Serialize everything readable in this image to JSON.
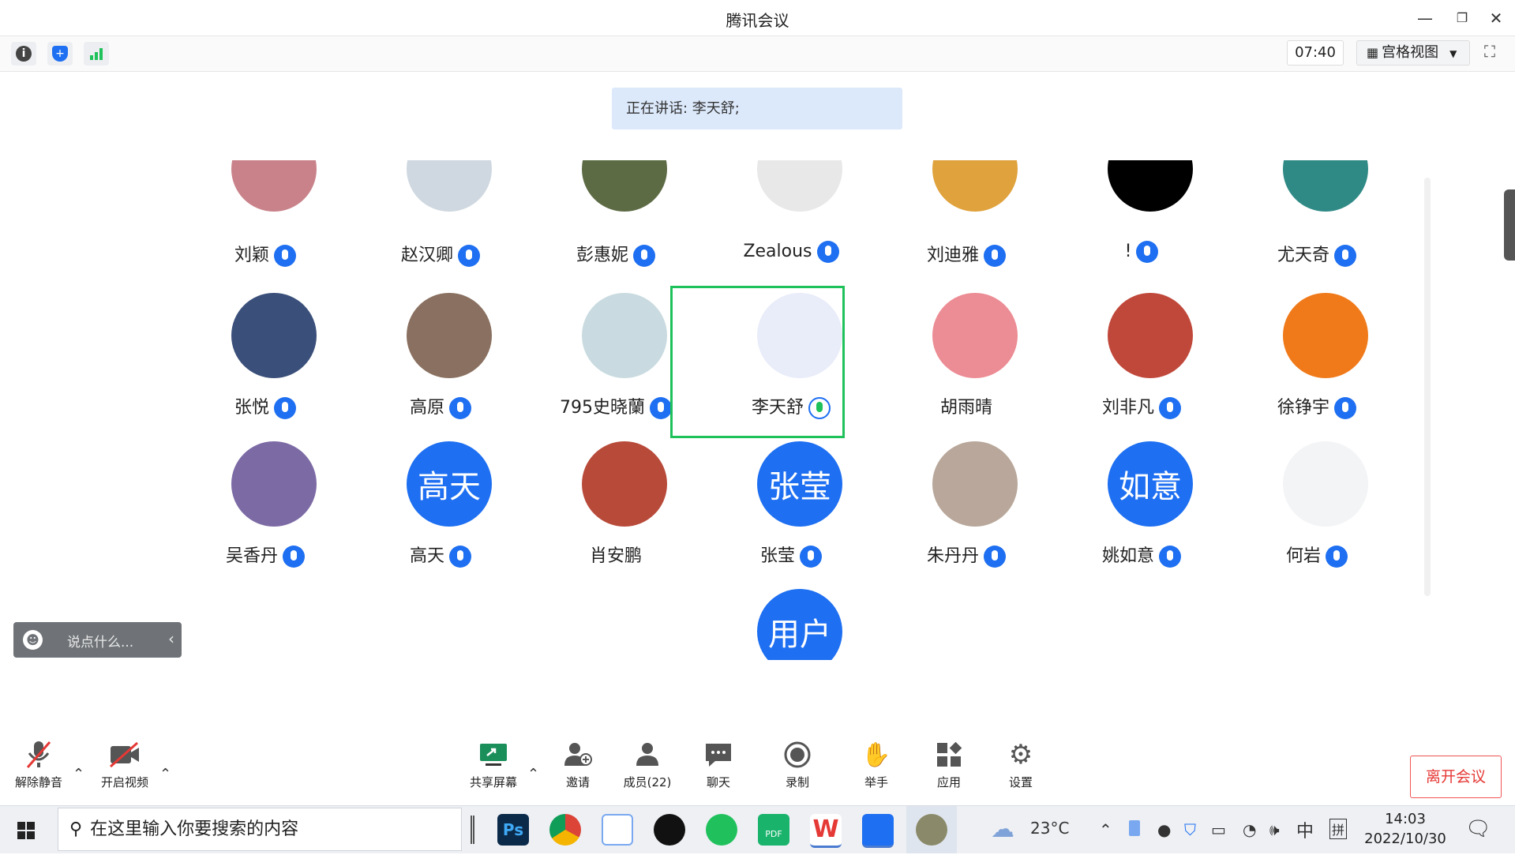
{
  "window": {
    "title": "腾讯会议"
  },
  "toolbar": {
    "time": "07:40",
    "view_label": "宫格视图"
  },
  "speaking": {
    "text": "正在讲话: 李天舒;"
  },
  "participants": [
    {
      "name": "刘颖",
      "avatar_text": "",
      "avatar_color": "#c9828a"
    },
    {
      "name": "赵汉卿",
      "avatar_text": "",
      "avatar_color": "#cfd8e0"
    },
    {
      "name": "彭惠妮",
      "avatar_text": "",
      "avatar_color": "#5d6b45"
    },
    {
      "name": "Zealous",
      "avatar_text": "",
      "avatar_color": "#e8e8e8"
    },
    {
      "name": "刘迪雅",
      "avatar_text": "",
      "avatar_color": "#e0a23c"
    },
    {
      "name": "!",
      "avatar_text": "",
      "avatar_color": "#000000"
    },
    {
      "name": "尤天奇",
      "avatar_text": "",
      "avatar_color": "#2f8a86"
    },
    {
      "name": "张悦",
      "avatar_text": "",
      "avatar_color": "#3a4f7a"
    },
    {
      "name": "高原",
      "avatar_text": "",
      "avatar_color": "#8a7060"
    },
    {
      "name": "795史晓蘭",
      "avatar_text": "",
      "avatar_color": "#c9dbe0"
    },
    {
      "name": "李天舒",
      "avatar_text": "",
      "avatar_color": "#e9ecf9"
    },
    {
      "name": "胡雨晴",
      "avatar_text": "",
      "avatar_color": "#ec8c94"
    },
    {
      "name": "刘非凡",
      "avatar_text": "",
      "avatar_color": "#c0483a"
    },
    {
      "name": "徐铮宇",
      "avatar_text": "",
      "avatar_color": "#f07a1a"
    },
    {
      "name": "吴香丹",
      "avatar_text": "",
      "avatar_color": "#7c6aa5"
    },
    {
      "name": "高天",
      "avatar_text": "高天",
      "avatar_color": "#1e6ff1"
    },
    {
      "name": "肖安鹏",
      "avatar_text": "",
      "avatar_color": "#b84a3a"
    },
    {
      "name": "张莹",
      "avatar_text": "张莹",
      "avatar_color": "#1e6ff1"
    },
    {
      "name": "朱丹丹",
      "avatar_text": "",
      "avatar_color": "#b8a79a"
    },
    {
      "name": "姚如意",
      "avatar_text": "如意",
      "avatar_color": "#1e6ff1"
    },
    {
      "name": "何岩",
      "avatar_text": "",
      "avatar_color": "#f3f4f6"
    },
    {
      "name": "",
      "avatar_text": "用户",
      "avatar_color": "#1e6ff1"
    }
  ],
  "chat": {
    "placeholder": "说点什么..."
  },
  "bottom": {
    "unmute": "解除静音",
    "video": "开启视频",
    "share": "共享屏幕",
    "invite": "邀请",
    "members": "成员(22)",
    "chat": "聊天",
    "record": "录制",
    "raise_hand": "举手",
    "apps": "应用",
    "settings": "设置",
    "leave": "离开会议"
  },
  "taskbar": {
    "search_placeholder": "在这里输入你要搜索的内容",
    "weather": "23°C",
    "ime": "中",
    "ime2": "拼",
    "time": "14:03",
    "date": "2022/10/30"
  },
  "colors": {
    "accent": "#1e6ff1",
    "active_border": "#1fc15a",
    "leave": "#e53935"
  }
}
